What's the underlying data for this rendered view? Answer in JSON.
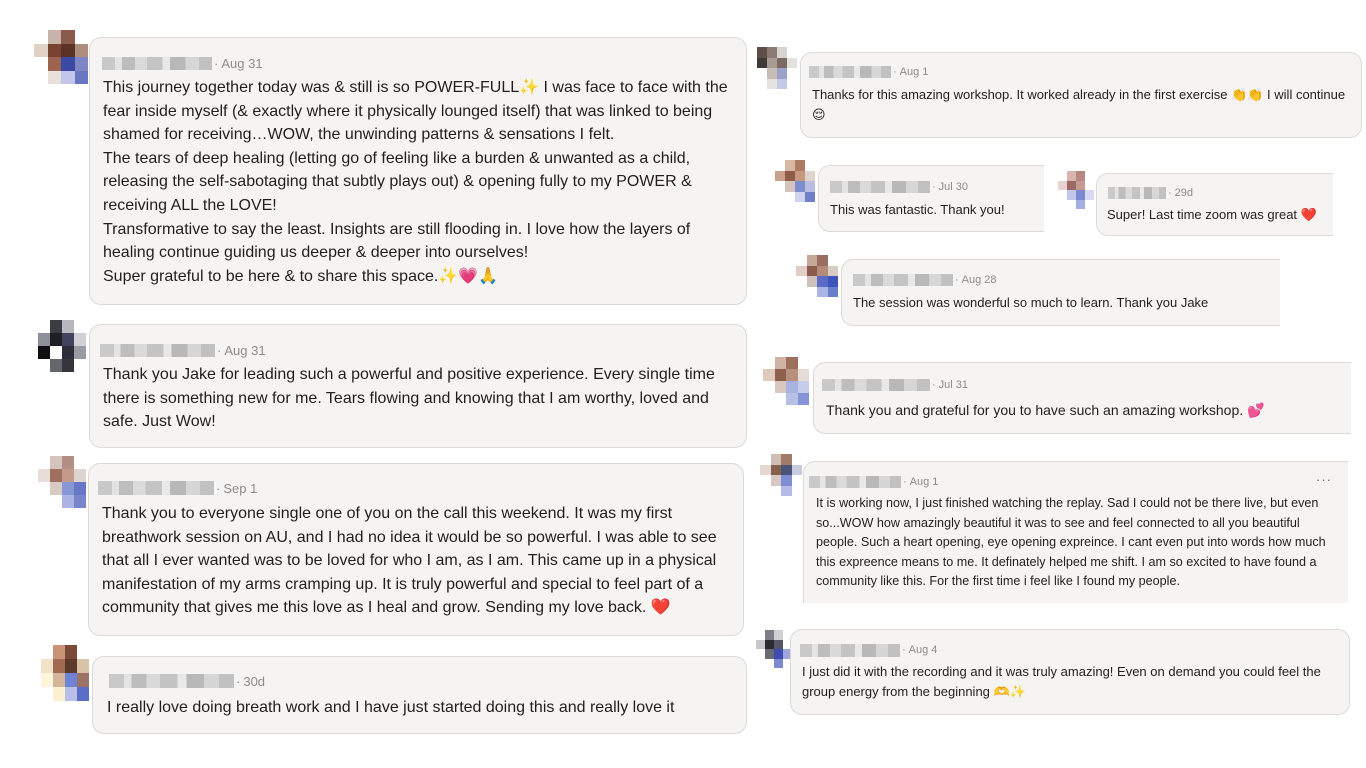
{
  "comments": [
    {
      "date": "Aug 31",
      "text": "This journey together today was & still is so POWER-FULL✨ I was face to face with the fear inside myself (& exactly where it physically lounged itself) that was linked to being shamed for receiving…WOW, the unwinding patterns & sensations I felt.\nThe tears of deep healing (letting go of feeling like a burden & unwanted as a child, releasing the self-sabotaging that subtly plays out) & opening fully to my POWER & receiving ALL the LOVE!\nTransformative to say the least. Insights are still flooding in. I love how the layers of healing continue guiding us deeper & deeper into ourselves!\nSuper grateful to be here & to share this space.✨💗🙏"
    },
    {
      "date": "Aug 31",
      "text": "Thank you Jake for leading such a powerful and positive experience. Every single time there is something new for me. Tears flowing and knowing that I am worthy, loved and safe. Just Wow!"
    },
    {
      "date": "Sep 1",
      "text": "Thank you to everyone single one of you on the call this weekend. It was my first breathwork session on AU, and I had no idea it would be so powerful. I was able to see that all I ever wanted was to be loved for who I am, as I am. This came up in a physical manifestation of my arms cramping up. It is truly powerful and special to feel part of a community that gives me this love as I heal and grow. Sending my love back. ❤️"
    },
    {
      "date": "30d",
      "text": "I really love doing breath work and I have just started doing this and really love it"
    },
    {
      "date": "Aug 1",
      "text": "Thanks for this amazing workshop. It worked already in the first exercise 👏👏 I will continue😌"
    },
    {
      "date": "Jul 30",
      "text": "This was fantastic. Thank you!"
    },
    {
      "date": "29d",
      "text": "Super! Last time zoom was great ❤️"
    },
    {
      "date": "Aug 28",
      "text": "The session was wonderful so much to learn. Thank you Jake"
    },
    {
      "date": "Jul 31",
      "text": "Thank you and grateful for you to have such an amazing workshop. 💕"
    },
    {
      "date": "Aug 1",
      "more": "···",
      "text": "It is working now, I just finished watching the replay. Sad I could not be there live, but even so...WOW how amazingly beautiful it was to see and feel connected to all you beautiful people. Such a heart opening, eye opening expreince. I cant even put into words how much this expreence means to me. It definately helped me shift. I am so excited to have found a community like this. For the first time i feel like I found my people."
    },
    {
      "date": "Aug 4",
      "text": "I just did it with the recording and it was truly amazing! Even on demand you could feel the group energy from the beginning 🫶✨"
    }
  ],
  "separator": "·",
  "colors": {
    "bubble_bg": "#f5f4f2",
    "bubble_border": "#dcdad6",
    "meta_text": "#8c8c8c",
    "body_text": "#1f1f1f",
    "heart": "#e0245e",
    "sparkle": "#f5c518"
  }
}
